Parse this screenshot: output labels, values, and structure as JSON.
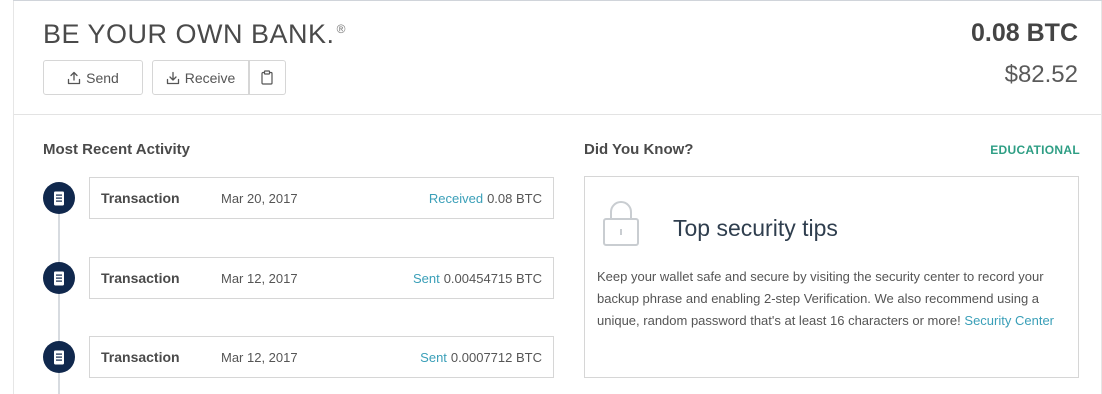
{
  "header": {
    "tagline": "BE YOUR OWN BANK.",
    "trademark": "®",
    "send_label": "Send",
    "receive_label": "Receive",
    "balance_btc": "0.08 BTC",
    "balance_fiat": "$82.52"
  },
  "activity": {
    "title": "Most Recent Activity",
    "transactions": [
      {
        "type": "Transaction",
        "date": "Mar 20, 2017",
        "direction": "Received",
        "amount": "0.08 BTC"
      },
      {
        "type": "Transaction",
        "date": "Mar 12, 2017",
        "direction": "Sent",
        "amount": "0.00454715 BTC"
      },
      {
        "type": "Transaction",
        "date": "Mar 12, 2017",
        "direction": "Sent",
        "amount": "0.0007712 BTC"
      }
    ]
  },
  "did_you_know": {
    "title": "Did You Know?",
    "category": "EDUCATIONAL",
    "heading": "Top security tips",
    "body": "Keep your wallet safe and secure by visiting the security center to record your backup phrase and enabling 2-step Verification. We also recommend using a unique, random password that's at least 16 characters or more!",
    "link_label": "Security Center"
  },
  "colors": {
    "accent_teal": "#3a9fb8",
    "educational_green": "#2e9e84",
    "timeline_navy": "#10284d"
  },
  "icons": {
    "send": "upload-icon",
    "receive": "download-icon",
    "copy": "clipboard-icon",
    "transaction": "receipt-icon",
    "security": "lock-icon"
  }
}
